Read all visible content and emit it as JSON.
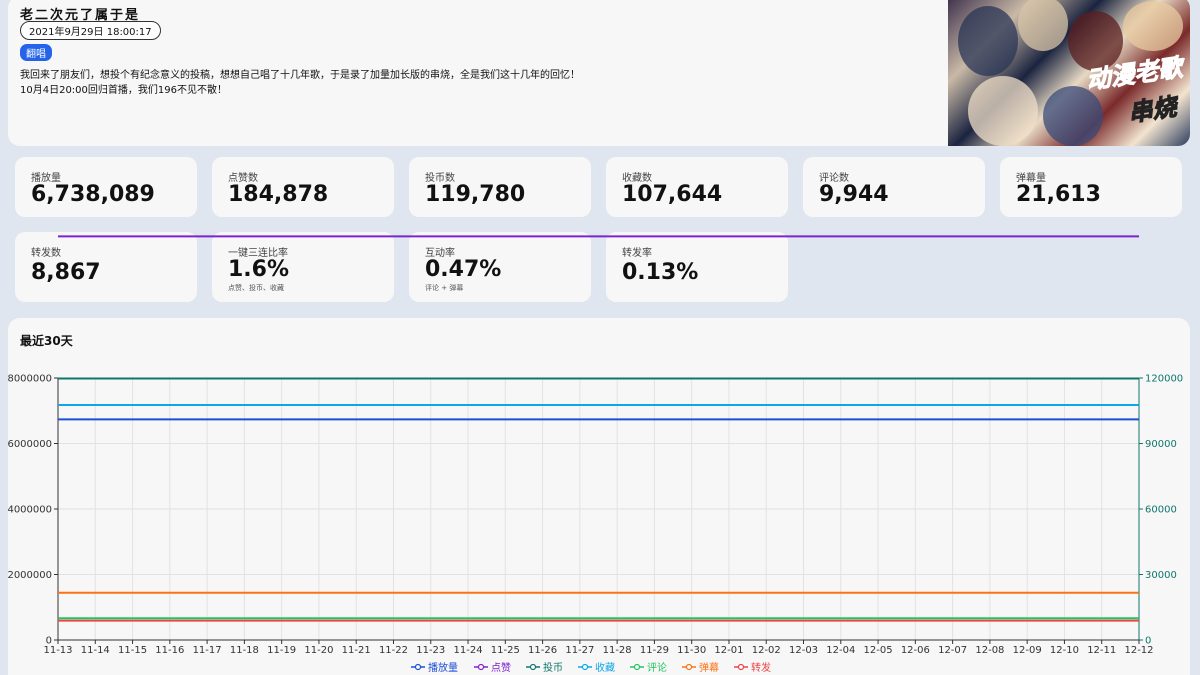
{
  "header": {
    "title": "老二次元了属于是",
    "date": "2021年9月29日 18:00:17",
    "tag": "翻唱",
    "description_line1": "我回来了朋友们，想投个有纪念意义的投稿，想想自己唱了十几年歌，于是录了加量加长版的串烧，全是我们这十几年的回忆！",
    "description_line2": "10月4日20:00回归首播，我们196不见不散！",
    "cover_text_1": "动漫老歌",
    "cover_text_2": "串烧"
  },
  "stats": [
    {
      "label": "播放量",
      "value": "6,738,089",
      "sub": ""
    },
    {
      "label": "点赞数",
      "value": "184,878",
      "sub": ""
    },
    {
      "label": "投币数",
      "value": "119,780",
      "sub": ""
    },
    {
      "label": "收藏数",
      "value": "107,644",
      "sub": ""
    },
    {
      "label": "评论数",
      "value": "9,944",
      "sub": ""
    },
    {
      "label": "弹幕量",
      "value": "21,613",
      "sub": ""
    },
    {
      "label": "转发数",
      "value": "8,867",
      "sub": ""
    },
    {
      "label": "一键三连比率",
      "value": "1.6%",
      "sub": "点赞、投币、收藏"
    },
    {
      "label": "互动率",
      "value": "0.47%",
      "sub": "评论 + 弹幕"
    },
    {
      "label": "转发率",
      "value": "0.13%",
      "sub": ""
    }
  ],
  "chart_section": {
    "title": "最近30天"
  },
  "chart_data": {
    "type": "line",
    "x": [
      "11-13",
      "11-14",
      "11-15",
      "11-16",
      "11-17",
      "11-18",
      "11-19",
      "11-20",
      "11-21",
      "11-22",
      "11-23",
      "11-24",
      "11-25",
      "11-26",
      "11-27",
      "11-28",
      "11-29",
      "11-30",
      "12-01",
      "12-02",
      "12-03",
      "12-04",
      "12-05",
      "12-06",
      "12-07",
      "12-08",
      "12-09",
      "12-10",
      "12-11",
      "12-12"
    ],
    "y_left": {
      "min": 0,
      "max": 8000000,
      "ticks": [
        0,
        2000000,
        4000000,
        6000000,
        8000000
      ],
      "tick_labels": [
        "0",
        "2000000",
        "4000000",
        "6000000",
        "8000000"
      ]
    },
    "y_right": {
      "min": 0,
      "max": 120000,
      "ticks": [
        0,
        30000,
        60000,
        90000,
        120000
      ],
      "tick_labels": [
        "0",
        "30000",
        "60000",
        "90000",
        "120000"
      ]
    },
    "grid": true,
    "legend_position": "bottom-center",
    "series": [
      {
        "name": "播放量",
        "axis": "left",
        "color": "#1d4ed8",
        "value": 6738089
      },
      {
        "name": "点赞",
        "axis": "right",
        "color": "#7e22ce",
        "value": 184878
      },
      {
        "name": "投币",
        "axis": "right",
        "color": "#0f766e",
        "value": 119780
      },
      {
        "name": "收藏",
        "axis": "right",
        "color": "#0ea5e9",
        "value": 107644
      },
      {
        "name": "评论",
        "axis": "right",
        "color": "#22c55e",
        "value": 9944
      },
      {
        "name": "弹幕",
        "axis": "right",
        "color": "#f97316",
        "value": 21613
      },
      {
        "name": "转发",
        "axis": "right",
        "color": "#ef4444",
        "value": 8867
      }
    ]
  }
}
